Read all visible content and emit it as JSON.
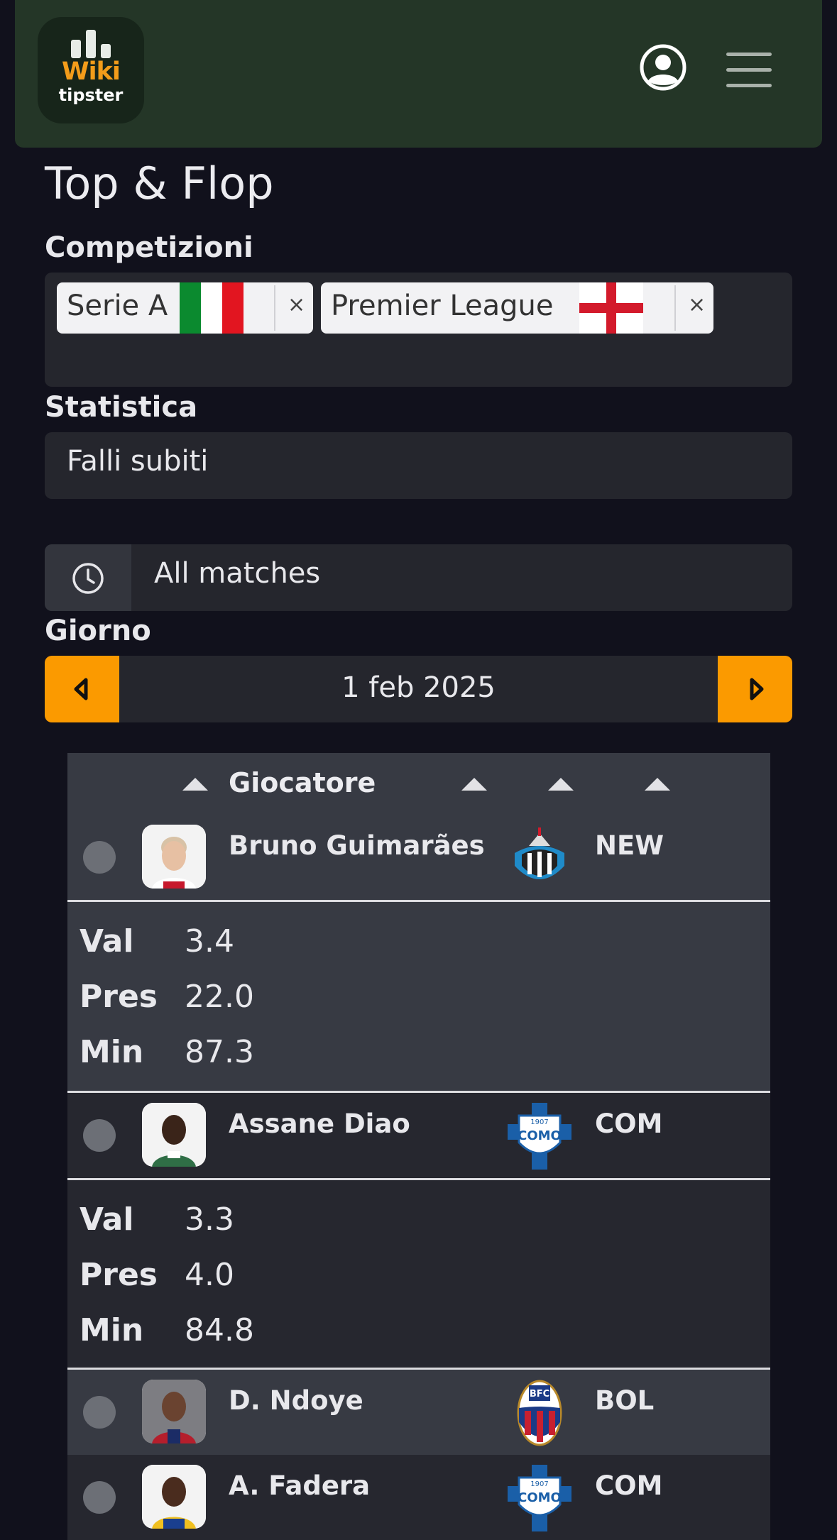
{
  "header": {
    "logo_line1": "Wiki",
    "logo_line2": "tipster",
    "user_icon": "user-circle-icon",
    "menu_icon": "hamburger-menu-icon"
  },
  "page_title": "Top & Flop",
  "competitions": {
    "label": "Competizioni",
    "chips": [
      {
        "label": "Serie A",
        "flag": "italy-flag-icon",
        "remove": "×"
      },
      {
        "label": "Premier League",
        "flag": "england-flag-icon",
        "remove": "×"
      }
    ]
  },
  "statistic": {
    "label": "Statistica",
    "value": "Falli subiti"
  },
  "matches_filter": {
    "icon": "clock-icon",
    "value": "All matches"
  },
  "day": {
    "label": "Giorno",
    "date": "1 feb 2025",
    "prev_icon": "caret-left-icon",
    "next_icon": "caret-right-icon"
  },
  "table": {
    "header": {
      "player": "Giocatore"
    },
    "rows": [
      {
        "name": "Bruno Guimarães",
        "team": "NEW",
        "expanded": true,
        "stats": [
          {
            "key": "Val",
            "value": "3.4"
          },
          {
            "key": "Pres",
            "value": "22.0"
          },
          {
            "key": "Min",
            "value": "87.3"
          }
        ]
      },
      {
        "name": "Assane Diao",
        "team": "COM",
        "expanded": true,
        "stats": [
          {
            "key": "Val",
            "value": "3.3"
          },
          {
            "key": "Pres",
            "value": "4.0"
          },
          {
            "key": "Min",
            "value": "84.8"
          }
        ]
      },
      {
        "name": "D. Ndoye",
        "team": "BOL",
        "expanded": false
      },
      {
        "name": "A. Fadera",
        "team": "COM",
        "expanded": false
      }
    ]
  },
  "colors": {
    "header_bg": "#243627",
    "accent": "#fb9a00",
    "page_bg": "#11111c"
  }
}
